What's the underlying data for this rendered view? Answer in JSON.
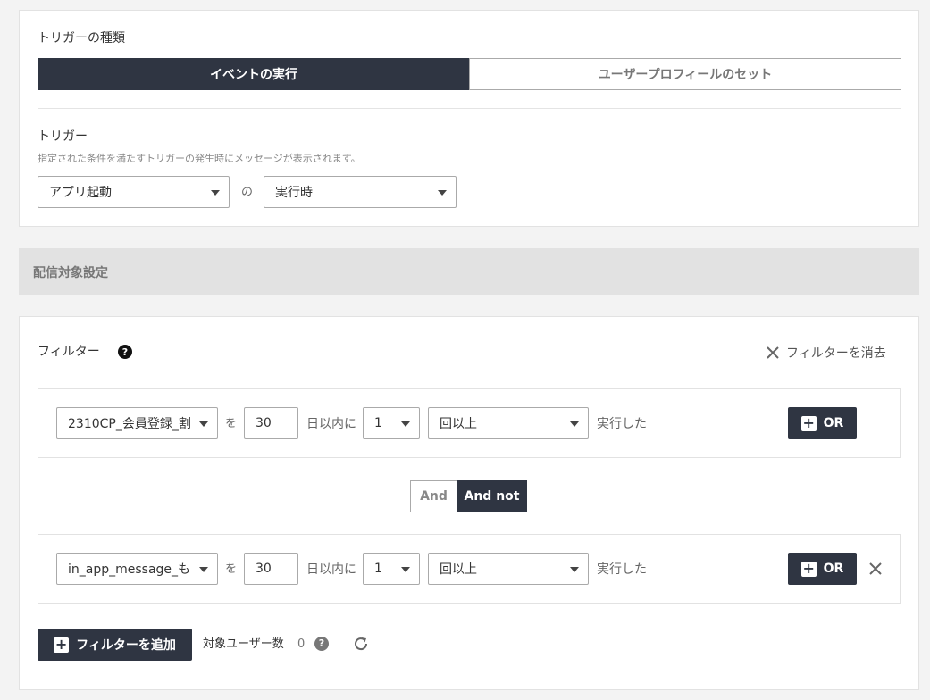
{
  "trigger_type": {
    "label": "トリガーの種類",
    "tabs": [
      "イベントの実行",
      "ユーザープロフィールのセット"
    ],
    "active_index": 0
  },
  "trigger": {
    "label": "トリガー",
    "hint": "指定された条件を満たすトリガーの発生時にメッセージが表示されます。",
    "event_select": "アプリ起動",
    "connector": "の",
    "timing_select": "実行時"
  },
  "delivery_section": {
    "title": "配信対象設定"
  },
  "filter": {
    "label": "フィルター",
    "clear_label": "フィルターを消去",
    "rows": [
      {
        "event": "2310CP_会員登録_割",
        "particle": "を",
        "days": "30",
        "days_suffix": "日以内に",
        "count": "1",
        "condition": "回以上",
        "suffix": "実行した",
        "or_label": "OR"
      },
      {
        "event": "in_app_message_も",
        "particle": "を",
        "days": "30",
        "days_suffix": "日以内に",
        "count": "1",
        "condition": "回以上",
        "suffix": "実行した",
        "or_label": "OR"
      }
    ],
    "logic": {
      "and_label": "And",
      "and_not_label": "And not",
      "selected": "And not"
    },
    "add_label": "フィルターを追加",
    "target_users_label": "対象ユーザー数",
    "target_users_count": "0"
  },
  "colors": {
    "dark": "#2f3542",
    "background": "#f3f3f3",
    "border": "#aaaaaa"
  },
  "icons": [
    "help-icon",
    "close-icon",
    "plus-icon",
    "refresh-icon",
    "caret-down-icon"
  ]
}
